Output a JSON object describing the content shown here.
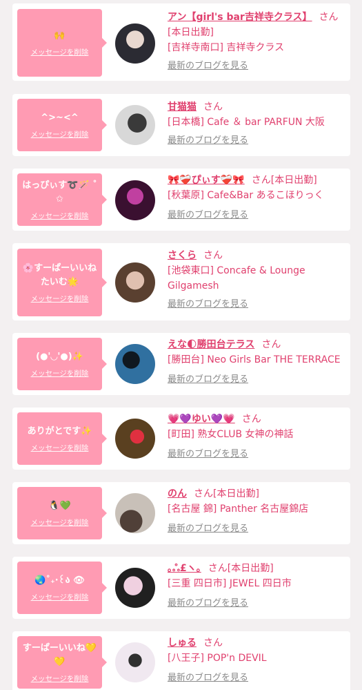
{
  "cards": [
    {
      "message": "🙌",
      "delete_label": "メッセージを削除",
      "name": "アン【girl's bar吉祥寺クラス】",
      "san": "さん",
      "tag": "",
      "tag2": "[本日出勤]",
      "shop": "[吉祥寺南口] 吉祥寺クラス",
      "blog": "最新のブログを見る",
      "avatar_colors": [
        "#2b2b33",
        "#e8d8d0"
      ]
    },
    {
      "message": "^>~<^",
      "delete_label": "メッセージを削除",
      "name": "甘猫猫",
      "san": "さん",
      "tag": "",
      "tag2": "",
      "shop": "[日本橋] Cafe ＆ bar PARFUN 大阪",
      "blog": "最新のブログを見る",
      "avatar_colors": [
        "#d8d8d8",
        "#3a3a3a"
      ]
    },
    {
      "message": "はっぴぃす➰🪄 ˚✩",
      "delete_label": "メッセージを削除",
      "name": "🎀❤️‍🩹ぴぃす❤️‍🩹🎀",
      "san": "さん",
      "tag": "[本日出勤]",
      "tag2": "",
      "shop": "[秋葉原] Cafe&Bar あるこほりっく",
      "blog": "最新のブログを見る",
      "avatar_colors": [
        "#3a1030",
        "#c040a0"
      ]
    },
    {
      "message": "🌸すーぱーいいねたいむ🌟",
      "delete_label": "メッセージを削除",
      "name": "さくら",
      "san": "さん",
      "tag": "",
      "tag2": "",
      "shop": "[池袋東口] Concafe & Lounge Gilgamesh",
      "blog": "最新のブログを見る",
      "avatar_colors": [
        "#5a4030",
        "#e0c0b0"
      ]
    },
    {
      "message": "(●'◡'●)✨",
      "delete_label": "メッセージを削除",
      "name": "えな🌓勝田台テラス",
      "san": "さん",
      "tag": "",
      "tag2": "",
      "shop": "[勝田台] Neo Girls Bar THE TERRACE",
      "blog": "最新のブログを見る",
      "avatar_colors": [
        "#3070a0",
        "#101820"
      ]
    },
    {
      "message": "ありがとです✨",
      "delete_label": "メッセージを削除",
      "name": "💗💜ゆい💜💗",
      "san": "さん",
      "tag": "",
      "tag2": "",
      "shop": "[町田] 熟女CLUB 女神の神話",
      "blog": "最新のブログを見る",
      "avatar_colors": [
        "#5a4020",
        "#e03040"
      ]
    },
    {
      "message": "🐧💚",
      "delete_label": "メッセージを削除",
      "name": "のん",
      "san": "さん",
      "tag": "[本日出勤]",
      "tag2": "",
      "shop": "[名古屋 錦] Panther 名古屋錦店",
      "blog": "最新のブログを見る",
      "avatar_colors": [
        "#c8c0b8",
        "#504038"
      ]
    },
    {
      "message": "🌏˚₊‧꒰ა 👁",
      "delete_label": "メッセージを削除",
      "name": "｡ஃ£ヽ｡",
      "san": "さん",
      "tag": "[本日出勤]",
      "tag2": "",
      "shop": "[三重 四日市] JEWEL 四日市",
      "blog": "最新のブログを見る",
      "avatar_colors": [
        "#f0d0e0",
        "#202020"
      ]
    },
    {
      "message": "すーぱーいいね💛💛",
      "delete_label": "メッセージを削除",
      "name": "しゅる",
      "san": "さん",
      "tag": "",
      "tag2": "",
      "shop": "[八王子] POP'n DEVIL",
      "blog": "最新のブログを見る",
      "avatar_colors": [
        "#f0e8f0",
        "#303030"
      ]
    }
  ]
}
